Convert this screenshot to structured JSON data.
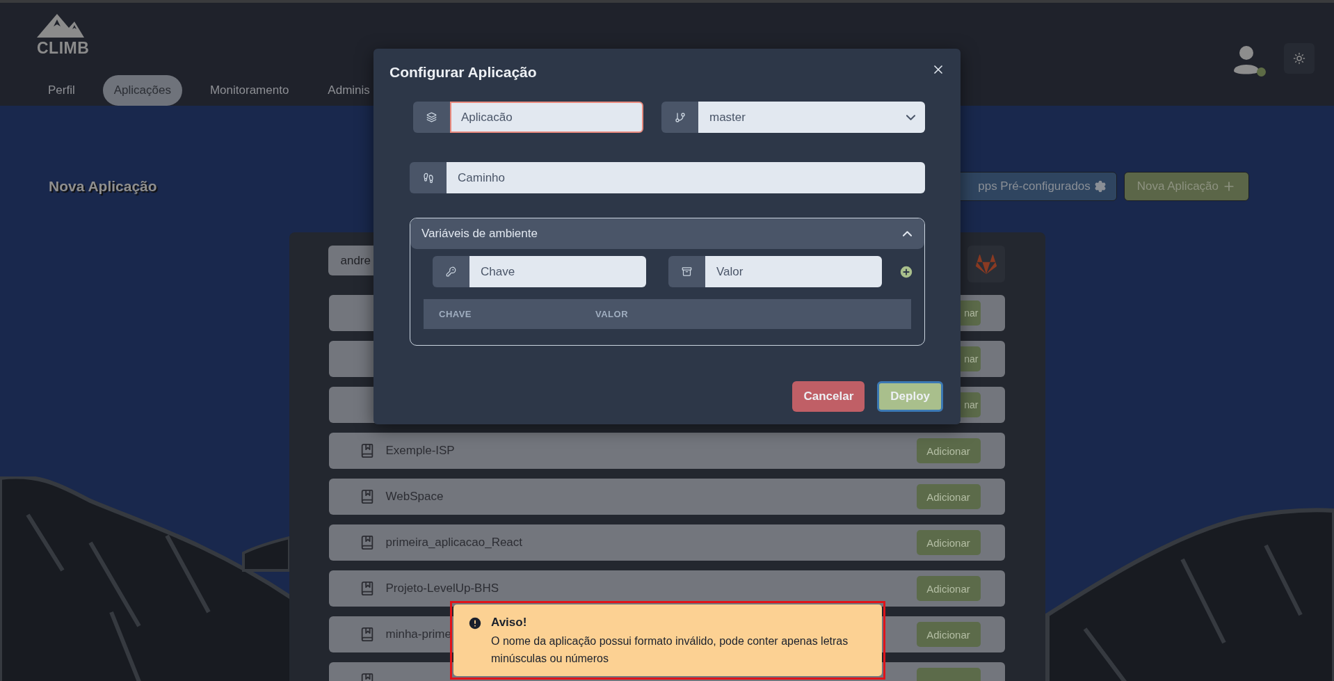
{
  "header": {
    "logo_text": "CLIMB",
    "tabs": [
      {
        "label": "Perfil",
        "selected": false
      },
      {
        "label": "Aplicações",
        "selected": true
      },
      {
        "label": "Monitoramento",
        "selected": false
      },
      {
        "label": "Adminis",
        "selected": false
      }
    ],
    "user": {
      "online": true
    }
  },
  "page": {
    "title": "Nova Aplicação",
    "buttons": [
      {
        "label": "pps Pré-configurados",
        "kind": "secondary"
      },
      {
        "label": "Nova Aplicação",
        "kind": "primary"
      }
    ]
  },
  "repositories": {
    "search": {
      "value": "andre"
    },
    "rows": [
      {
        "kind": "covered",
        "button": "nar"
      },
      {
        "kind": "covered",
        "button": "nar"
      },
      {
        "kind": "covered",
        "button": "nar"
      },
      {
        "kind": "full",
        "name": "Exemple-ISP",
        "button": "Adicionar"
      },
      {
        "kind": "full",
        "name": "WebSpace",
        "button": "Adicionar"
      },
      {
        "kind": "full",
        "name": "primeira_aplicacao_React",
        "button": "Adicionar"
      },
      {
        "kind": "full",
        "name": "Projeto-LevelUp-BHS",
        "button": "Adicionar"
      },
      {
        "kind": "full",
        "name": "minha-prime",
        "button": "Adicionar"
      },
      {
        "kind": "cut"
      }
    ]
  },
  "modal": {
    "title": "Configurar Aplicação",
    "name_field": {
      "value": "Aplicacão",
      "invalid": true
    },
    "branch_select": {
      "value": "master"
    },
    "path_field": {
      "placeholder": "Caminho"
    },
    "env_section": {
      "title": "Variáveis de ambiente",
      "expanded": true,
      "key_field": {
        "placeholder": "Chave"
      },
      "value_field": {
        "placeholder": "Valor"
      },
      "columns": [
        "CHAVE",
        "VALOR"
      ]
    },
    "buttons": [
      {
        "label": "Cancelar",
        "kind": "danger",
        "focused": false
      },
      {
        "label": "Deploy",
        "kind": "confirm",
        "focused": true
      }
    ]
  },
  "toast": {
    "title": "Aviso!",
    "message": "O nome da aplicação possui formato inválido, pode conter apenas letras minúsculas ou números",
    "outlined": true
  }
}
